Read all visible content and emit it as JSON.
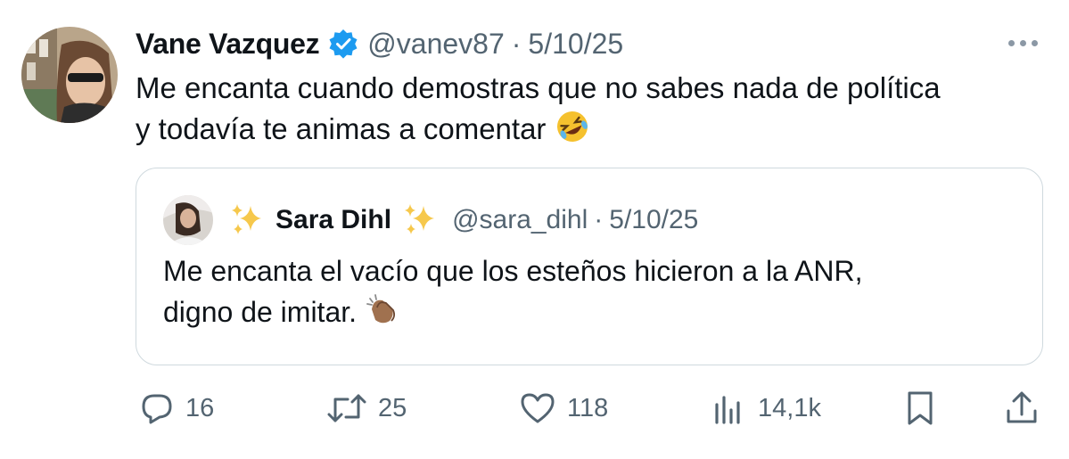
{
  "tweet": {
    "author": {
      "display_name": "Vane Vazquez",
      "handle": "@vanev87",
      "verified": true
    },
    "separator": "·",
    "date": "5/10/25",
    "text_line1": "Me encanta cuando demostras que no sabes nada de política",
    "text_line2": "y todavía te animas a comentar",
    "emoji": "rolling-on-floor-laughing"
  },
  "quote": {
    "author": {
      "display_name": "Sara Dihl",
      "handle": "@sara_dihl",
      "name_decoration": "sparkles"
    },
    "separator": "·",
    "date": "5/10/25",
    "text_line1": "Me encanta el vacío que los esteños hicieron a la ANR,",
    "text_line2": "digno de imitar.",
    "emoji": "clapping-hands"
  },
  "actions": {
    "replies": "16",
    "reposts": "25",
    "likes": "118",
    "views": "14,1k"
  },
  "colors": {
    "text": "#0f1419",
    "secondary": "#536471",
    "verified_blue": "#1d9bf0",
    "border": "#cfd9de"
  }
}
